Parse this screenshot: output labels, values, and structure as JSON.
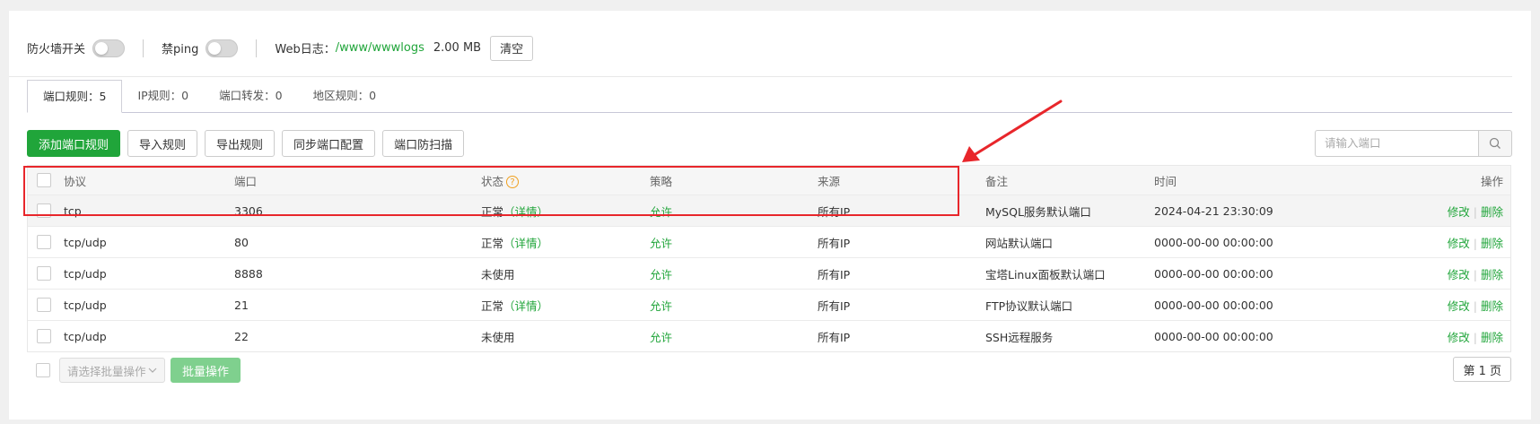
{
  "topbar": {
    "firewall_label": "防火墙开关",
    "ping_label": "禁ping",
    "weblog_label": "Web日志：",
    "weblog_path": "/www/wwwlogs",
    "weblog_size": "2.00 MB",
    "clear_button": "清空"
  },
  "tabs": [
    {
      "label": "端口规则：5"
    },
    {
      "label": "IP规则：0"
    },
    {
      "label": "端口转发：0"
    },
    {
      "label": "地区规则：0"
    }
  ],
  "actions": {
    "add": "添加端口规则",
    "import": "导入规则",
    "export": "导出规则",
    "sync": "同步端口配置",
    "scan": "端口防扫描"
  },
  "search": {
    "placeholder": "请输入端口"
  },
  "table": {
    "headers": {
      "protocol": "协议",
      "port": "端口",
      "status": "状态",
      "policy": "策略",
      "source": "来源",
      "remark": "备注",
      "time": "时间",
      "op": "操作"
    },
    "rows": [
      {
        "protocol": "tcp",
        "port": "3306",
        "status": "正常",
        "detail": "（详情）",
        "policy": "允许",
        "source": "所有IP",
        "remark": "MySQL服务默认端口",
        "time": "2024-04-21 23:30:09"
      },
      {
        "protocol": "tcp/udp",
        "port": "80",
        "status": "正常",
        "detail": "（详情）",
        "policy": "允许",
        "source": "所有IP",
        "remark": "网站默认端口",
        "time": "0000-00-00 00:00:00"
      },
      {
        "protocol": "tcp/udp",
        "port": "8888",
        "status": "未使用",
        "detail": "",
        "policy": "允许",
        "source": "所有IP",
        "remark": "宝塔Linux面板默认端口",
        "time": "0000-00-00 00:00:00"
      },
      {
        "protocol": "tcp/udp",
        "port": "21",
        "status": "正常",
        "detail": "（详情）",
        "policy": "允许",
        "source": "所有IP",
        "remark": "FTP协议默认端口",
        "time": "0000-00-00 00:00:00"
      },
      {
        "protocol": "tcp/udp",
        "port": "22",
        "status": "未使用",
        "detail": "",
        "policy": "允许",
        "source": "所有IP",
        "remark": "SSH远程服务",
        "time": "0000-00-00 00:00:00"
      }
    ],
    "op_edit": "修改",
    "op_delete": "删除"
  },
  "bottom": {
    "batch_select_placeholder": "请选择批量操作",
    "batch_button": "批量操作",
    "page": "第 1 页"
  },
  "colors": {
    "accent": "#20a53a",
    "annotation": "#e8262b"
  }
}
